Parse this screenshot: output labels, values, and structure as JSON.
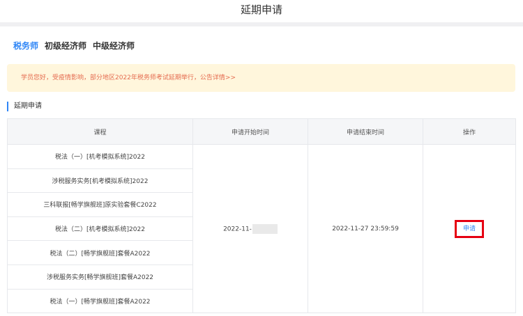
{
  "header": {
    "title": "延期申请"
  },
  "tabs": [
    {
      "label": "税务师",
      "active": true
    },
    {
      "label": "初级经济师",
      "active": false
    },
    {
      "label": "中级经济师",
      "active": false
    }
  ],
  "notice": {
    "text": "学员您好，受疫情影响，部分地区2022年税务师考试延期举行，公告详情>>"
  },
  "section": {
    "title": "延期申请"
  },
  "table": {
    "headers": [
      "课程",
      "申请开始时间",
      "申请结束时间",
      "操作"
    ],
    "courses": [
      "税法（一）[机考模拟系统]2022",
      "涉税服务实务[机考模拟系统]2022",
      "三科联报[畅学旗舰班]原实验套餐C2022",
      "税法（二）[机考模拟系统]2022",
      "税法（二）[畅学旗舰班]套餐A2022",
      "涉税服务实务[畅学旗舰班]套餐A2022",
      "税法（一）[畅学旗舰班]套餐A2022"
    ],
    "start_time": "2022-11-",
    "end_time": "2022-11-27 23:59:59",
    "action_label": "申请"
  },
  "colors": {
    "accent": "#2f86f6",
    "notice_bg": "#fff6dc",
    "notice_text": "#e56b4f",
    "highlight": "#e60012"
  }
}
